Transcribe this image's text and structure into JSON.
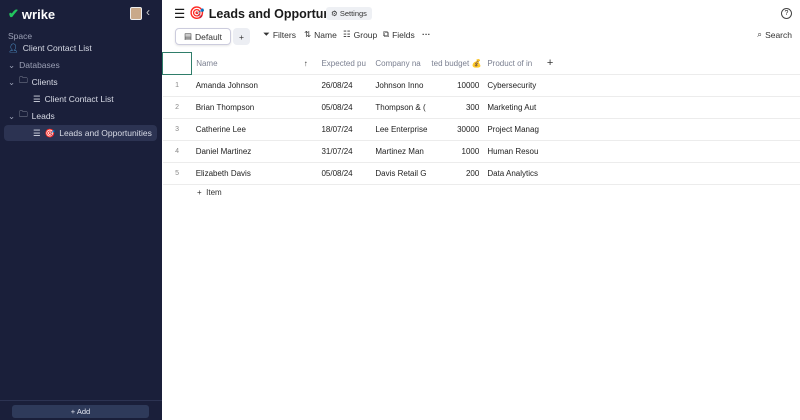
{
  "app": {
    "logo": "wrike"
  },
  "sidebar": {
    "space_label": "Space",
    "items": [
      {
        "label": "Client Contact List",
        "icon": "user-icon"
      },
      {
        "label": "Databases",
        "icon": "chevron-down-icon"
      },
      {
        "label": "Clients",
        "icon": "folder-icon"
      },
      {
        "label": "Client Contact List",
        "icon": "list-icon"
      },
      {
        "label": "Leads",
        "icon": "folder-icon"
      },
      {
        "label": "Leads and Opportunities",
        "icon": "list-icon",
        "emoji": "🎯",
        "selected": true
      }
    ],
    "add_label": "Add"
  },
  "header": {
    "title": "Leads and Opportunities",
    "emoji": "🎯",
    "settings_label": "Settings",
    "help": "?"
  },
  "toolbar": {
    "view": "Default",
    "add": "+",
    "filters": "Filters",
    "sort": "Name",
    "group": "Group",
    "fields": "Fields",
    "more": "···",
    "search": "Search"
  },
  "table": {
    "columns": [
      "Name",
      "↑",
      "Expected pu",
      "Company na",
      "ted budget 💰",
      "Product of in",
      "+"
    ],
    "rows": [
      [
        "1",
        "Amanda Johnson",
        "26/08/24",
        "Johnson Inno",
        "10000",
        "Cybersecurity"
      ],
      [
        "2",
        "Brian Thompson",
        "05/08/24",
        "Thompson & (",
        "300",
        "Marketing Aut"
      ],
      [
        "3",
        "Catherine Lee",
        "18/07/24",
        "Lee Enterprise",
        "30000",
        "Project Manag"
      ],
      [
        "4",
        "Daniel Martinez",
        "31/07/24",
        "Martinez Man",
        "1000",
        "Human Resou"
      ],
      [
        "5",
        "Elizabeth Davis",
        "05/08/24",
        "Davis Retail G",
        "200",
        "Data Analytics"
      ]
    ],
    "add_item": "Item"
  },
  "colors": {
    "sidebar": "#1a1f3a",
    "accent": "#2f7d6a",
    "logo": "#22c55e"
  }
}
